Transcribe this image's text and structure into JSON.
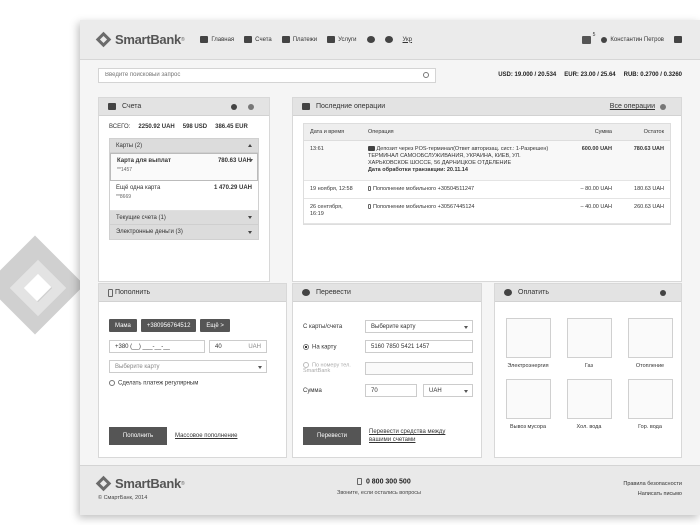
{
  "header": {
    "logo_text": "SmartBank",
    "nav": [
      "Главная",
      "Счета",
      "Платежи",
      "Услуги"
    ],
    "lang": "Укр",
    "notif_count": "5",
    "user_name": "Константин Петров"
  },
  "search": {
    "placeholder": "Введите поисковый запрос"
  },
  "rates": [
    "USD: 19.000 / 20.534",
    "EUR: 23.00 / 25.64",
    "RUB: 0.2700 / 0.3260"
  ],
  "accounts": {
    "title": "Счета",
    "total_label": "ВСЕГО:",
    "totals": [
      "2250.92 UAH",
      "598 USD",
      "386.45 EUR"
    ],
    "group_cards": "Карты (2)",
    "cards": [
      {
        "name": "Карта для выплат",
        "number": "**1457",
        "amount": "780.63 UAH"
      },
      {
        "name": "Ещё одна карта",
        "number": "**8669",
        "amount": "1 470.29 UAH"
      }
    ],
    "group_current": "Текущие счета (1)",
    "group_emoney": "Электронные деньги (3)"
  },
  "operations": {
    "title": "Последние операции",
    "all_link": "Все операции",
    "columns": [
      "Дата и время",
      "Операция",
      "Сумма",
      "Остаток"
    ],
    "rows": [
      {
        "date": "13:61",
        "desc": "Депозит через POS-терминал(Ответ авторизац. сист.: 1-Разрешен) ТЕРМИНАЛ САМООБСЛУЖИВАНИЯ, УКРАИНА, КИЕВ, УЛ. ХАРЬКОВСКОЕ ШОССЕ, 56 ДАРНИЦКОЕ ОТДЕЛЕНИЕ",
        "note": "Дата обработки транзакции: 20.11.14",
        "sum": "600.00 UAH",
        "rest": "780.63 UAH"
      },
      {
        "date": "19 ноября, 12:58",
        "desc": "Пополнение мобильного +30504511247",
        "note": "",
        "sum": "– 80.00 UAH",
        "rest": "180.63 UAH"
      },
      {
        "date": "26 сентября, 16:19",
        "desc": "Пополнение мобильного +30567445124",
        "note": "",
        "sum": "– 40.00 UAH",
        "rest": "260.63 UAH"
      }
    ]
  },
  "topup": {
    "title": "Пополнить",
    "contacts": [
      "Мама",
      "+380956764512",
      "Ещё >"
    ],
    "phone_value": "+380 (__) ___-__-__",
    "amount_value": "40",
    "currency": "UAH",
    "card_select": "Выберите карту",
    "regular_label": "Сделать платеж регулярным",
    "submit": "Пополнить",
    "bulk_link": "Массовое пополнение"
  },
  "transfer": {
    "title": "Перевести",
    "from_label": "С карты/счета",
    "from_select": "Выберите карту",
    "to_card_label": "На карту",
    "to_card_value": "5160 7850 5421 1457",
    "to_number_label": "По номеру тел. SmartBank",
    "sum_label": "Сумма",
    "sum_value": "70",
    "sum_currency": "UAH",
    "submit": "Перевести",
    "between_link": "Перевести средства между вашими счетами"
  },
  "pay": {
    "title": "Оплатить",
    "tiles": [
      "Электроэнергия",
      "Газ",
      "Отопление",
      "Вывоз мусора",
      "Хол. вода",
      "Гор. вода"
    ]
  },
  "footer": {
    "logo_text": "SmartBank",
    "copyright": "© СмартБанк, 2014",
    "phone": "0 800 300 500",
    "phone_sub": "Звоните, если остались вопросы",
    "links": [
      "Правила безопасности",
      "Написать письмо"
    ]
  }
}
